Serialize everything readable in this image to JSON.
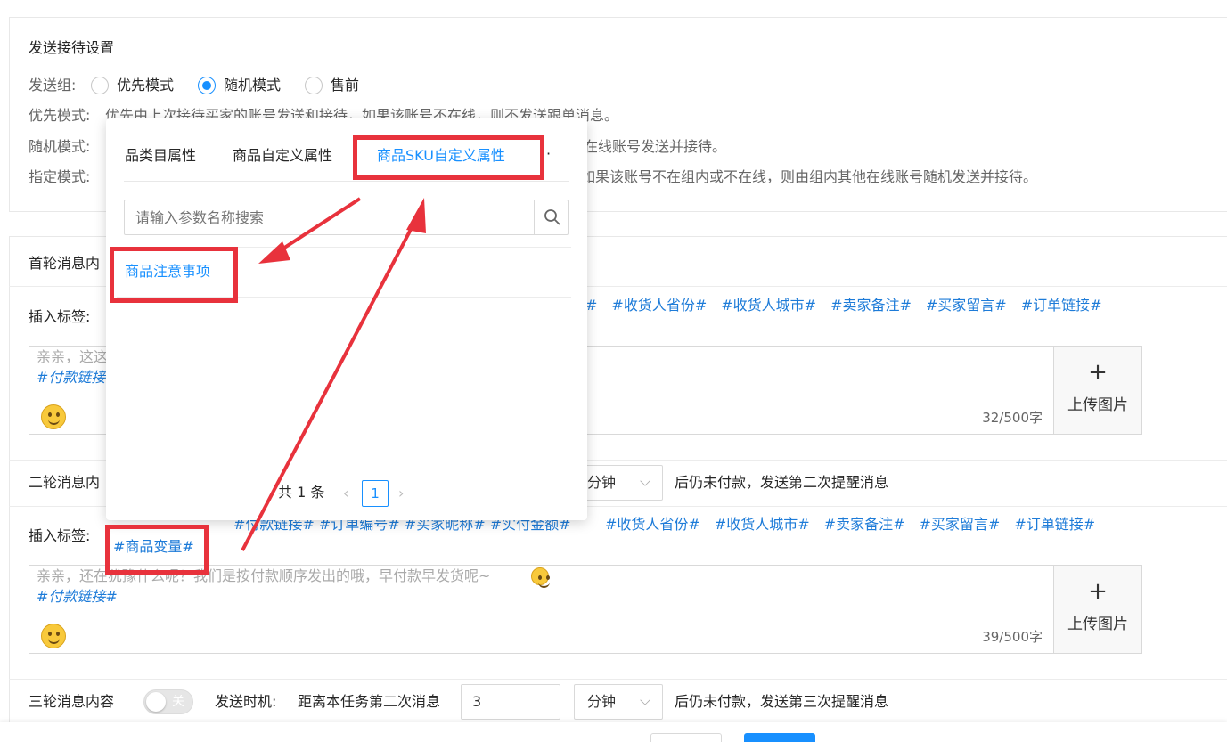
{
  "section1": {
    "title": "发送接待设置",
    "group_label": "发送组:",
    "options": [
      "优先模式",
      "随机模式",
      "售前"
    ],
    "selected_option": "随机模式",
    "desc": [
      {
        "label": "优先模式:",
        "text": "优先由上次接待买家的账号发送和接待，如果该账号不在线，则不发送跟单消息。"
      },
      {
        "label": "随机模式:",
        "text": "在线账号发送并接待。"
      },
      {
        "label": "指定模式:",
        "text": "如果该账号不在组内或不在线，则由组内其他在线账号随机发送并接待。"
      }
    ]
  },
  "msg1": {
    "title": "首轮消息内",
    "insert_label": "插入标签:",
    "tags": [
      "#",
      "#收货人省份#",
      "#收货人城市#",
      "#卖家备注#",
      "#买家留言#",
      "#订单链接#"
    ],
    "content_line1": "亲亲，这这",
    "content_line2": "#付款链接",
    "counter": "32/500字",
    "upload_plus": "+",
    "upload_label": "上传图片"
  },
  "msg2": {
    "title": "二轮消息内",
    "unit": "分钟",
    "after_text": "后仍未付款，发送第二次提醒消息",
    "insert_label": "插入标签:",
    "tags_partial": "#付款链接#   #订单编号#   #买家昵称#   #实付金额#",
    "tags": [
      "#收货人省份#",
      "#收货人城市#",
      "#卖家备注#",
      "#买家留言#",
      "#订单链接#"
    ],
    "extra_tag": "#商品变量#",
    "content_line1": "亲亲，还在犹豫什么呢？我们是按付款顺序发出的哦，早付款早发货呢~",
    "content_line2": "#付款链接#",
    "counter": "39/500字",
    "upload_plus": "+",
    "upload_label": "上传图片"
  },
  "msg3": {
    "title": "三轮消息内容",
    "toggle_text": "关",
    "timing_label": "发送时机:",
    "timing_text": "距离本任务第二次消息",
    "value": "3",
    "unit": "分钟",
    "after_text": "后仍未付款，发送第三次提醒消息"
  },
  "popup": {
    "tabs": [
      "品类目属性",
      "商品自定义属性",
      "商品SKU自定义属性"
    ],
    "active_tab": "商品SKU自定义属性",
    "more": "·",
    "search_placeholder": "请输入参数名称搜索",
    "items": [
      "商品注意事项"
    ],
    "total": "共 1 条",
    "page": "1"
  },
  "colors": {
    "accent": "#1890ff",
    "tag": "#1d7bd8",
    "annotation": "#e8323c"
  }
}
